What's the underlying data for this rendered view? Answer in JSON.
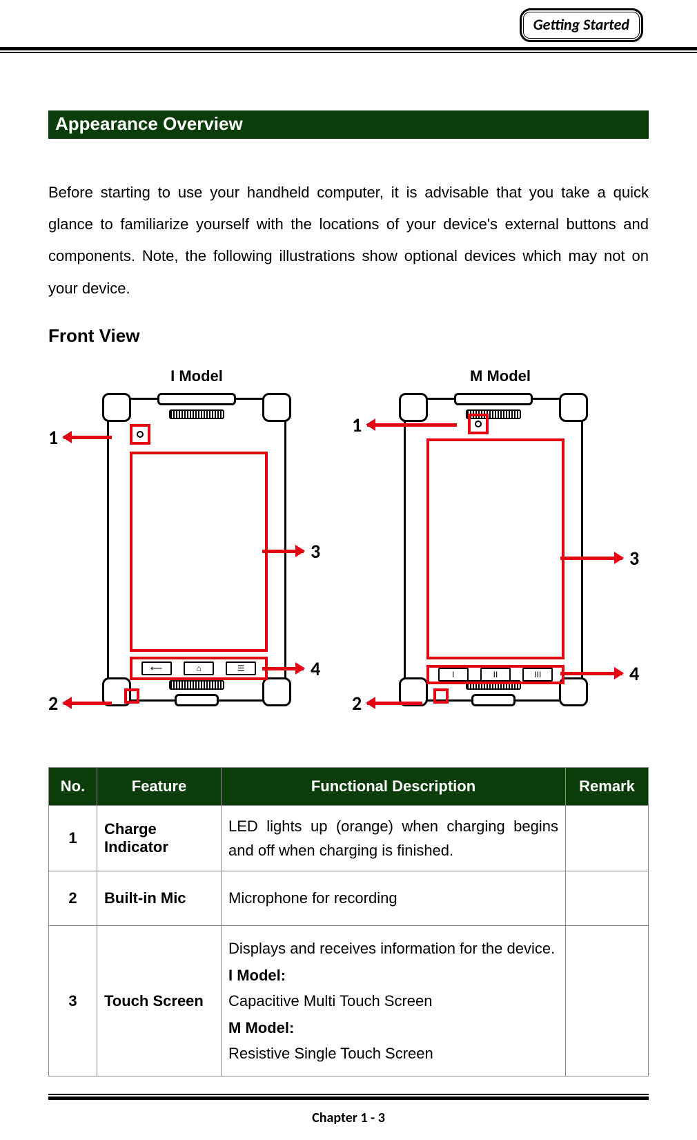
{
  "header": {
    "badge": "Getting Started"
  },
  "section_title": "Appearance Overview",
  "intro": "Before starting to use your handheld computer, it is advisable that you take a quick glance to familiarize yourself with the locations of your device's external buttons and components. Note, the following illustrations show optional devices which may not on your device.",
  "subheading": "Front View",
  "diagrams": {
    "left_label": "I Model",
    "right_label": "M Model",
    "callouts": {
      "n1": "1",
      "n2": "2",
      "n3": "3",
      "n4": "4"
    },
    "i_nav": {
      "a": "⟵",
      "b": "⌂",
      "c": "☰"
    },
    "m_nav": {
      "a": "I",
      "b": "II",
      "c": "III"
    }
  },
  "table": {
    "headers": {
      "no": "No.",
      "feature": "Feature",
      "desc": "Functional Description",
      "remark": "Remark"
    },
    "rows": [
      {
        "no": "1",
        "feature": "Charge Indicator",
        "desc_plain": "LED lights up (orange) when charging begins and off when charging is finished.",
        "remark": ""
      },
      {
        "no": "2",
        "feature": "Built-in Mic",
        "desc_plain": "Microphone for recording",
        "remark": ""
      },
      {
        "no": "3",
        "feature": "Touch Screen",
        "desc_lines": {
          "lead": "Displays and receives information for the device.",
          "i_label": "I Model:",
          "i_text": "Capacitive Multi Touch Screen",
          "m_label": "M Model:",
          "m_text": "Resistive Single Touch Screen"
        },
        "remark": ""
      }
    ]
  },
  "footer": "Chapter 1 - 3"
}
